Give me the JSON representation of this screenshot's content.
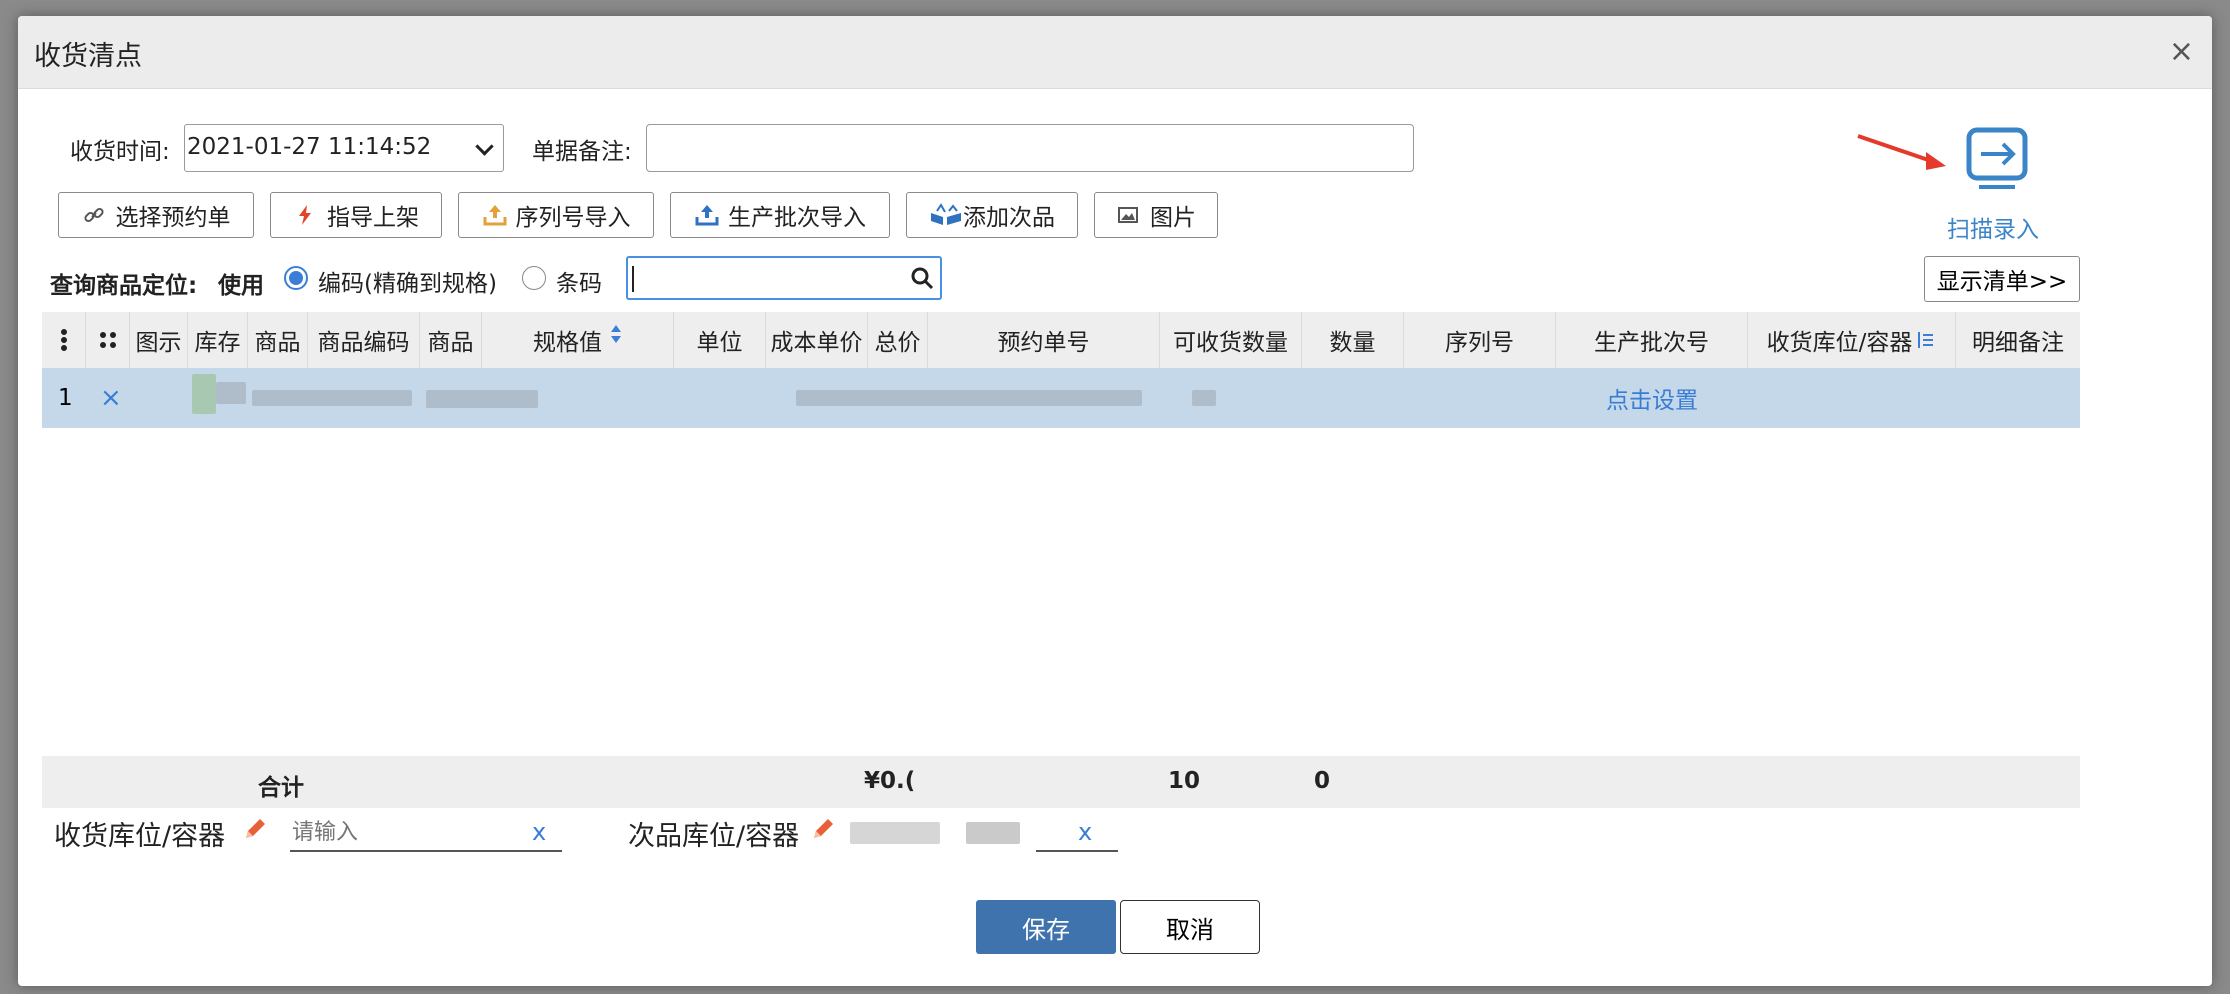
{
  "dialog": {
    "title": "收货清点",
    "close_glyph": "×"
  },
  "form": {
    "receive_time_label": "收货时间:",
    "receive_time_value": "2021-01-27 11:14:52",
    "remark_label": "单据备注:",
    "remark_value": ""
  },
  "toolbar": [
    {
      "label": "选择预约单",
      "icon": "link-icon",
      "color": "#555555"
    },
    {
      "label": "指导上架",
      "icon": "lightning-icon",
      "color": "#e0452b"
    },
    {
      "label": "序列号导入",
      "icon": "upload-tray-icon",
      "color": "#e2a23b"
    },
    {
      "label": "生产批次导入",
      "icon": "upload-tray-icon",
      "color": "#2f73c0"
    },
    {
      "label": "添加次品",
      "icon": "broken-box-icon",
      "color": "#2f73c0"
    },
    {
      "label": "图片",
      "icon": "image-icon",
      "color": "#555555"
    }
  ],
  "scan": {
    "label": "扫描录入",
    "icon": "scan-enter-icon",
    "color": "#3a84c8"
  },
  "query": {
    "label_prefix": "查询商品定位:",
    "label_use": "使用",
    "option_code": "编码(精确到规格)",
    "option_barcode": "条码",
    "selected": "option_code",
    "search_value": "",
    "show_list_label": "显示清单>>"
  },
  "grid": {
    "columns": [
      "",
      "",
      "图示",
      "库存",
      "商品",
      "商品编码",
      "商品",
      "规格值",
      "单位",
      "成本单价",
      "总价",
      "预约单号",
      "可收货数量",
      "数量",
      "序列号",
      "生产批次号",
      "收货库位/容器",
      "明细备注"
    ],
    "rows": [
      {
        "index": "1",
        "delete": "×",
        "batch_link": "点击设置"
      }
    ],
    "footer": {
      "label": "合计",
      "total_price": "¥0.(",
      "receivable_qty": "10",
      "qty": "0"
    }
  },
  "bottom": {
    "receive_loc_label": "收货库位/容器",
    "receive_loc_placeholder": "请输入",
    "defect_loc_label": "次品库位/容器",
    "clear_glyph": "x"
  },
  "actions": {
    "save": "保存",
    "cancel": "取消"
  },
  "colors": {
    "accent": "#3a84c8",
    "primary_button": "#3f73ad",
    "selected_row": "#c4d8ea",
    "arrow": "#e53a2b"
  }
}
